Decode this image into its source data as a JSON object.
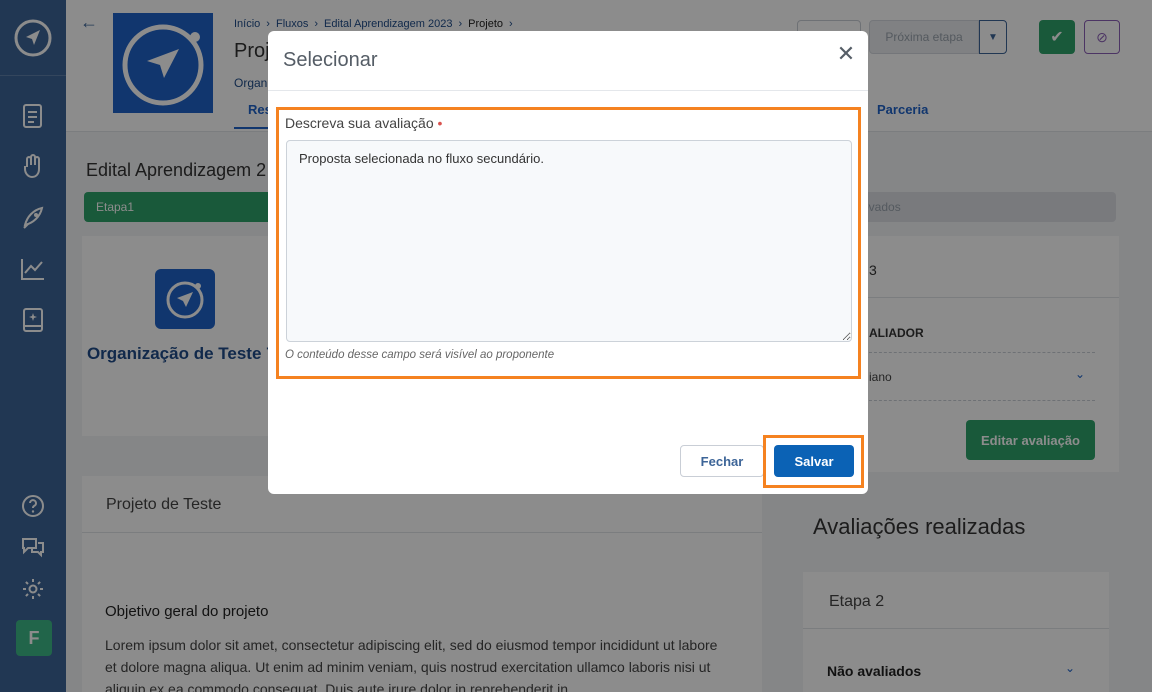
{
  "header": {
    "breadcrumb": [
      "Início",
      "Fluxos",
      "Edital Aprendizagem 2023",
      "Projeto"
    ],
    "project_title": "Proj",
    "org_subtitle": "Organ",
    "tab_res": "Res",
    "tab_parceria": "Parceria",
    "next_step_label": "Próxima etapa"
  },
  "page": {
    "edital_title": "Edital Aprendizagem 2",
    "etapa_label": "Etapa1",
    "aprovados_label": "rovados",
    "org_name": "Organização de Teste 72",
    "right_card_num": "3",
    "avaliador_label": "ALIADOR",
    "avaliador_name": "iano",
    "edit_button": "Editar avaliação",
    "project_card_title": "Projeto de Teste",
    "objective_title": "Objetivo geral do projeto",
    "lorem": "Lorem ipsum dolor sit amet, consectetur adipiscing elit, sed do eiusmod tempor incididunt ut labore et dolore magna aliqua. Ut enim ad minim veniam, quis nostrud exercitation ullamco laboris nisi ut aliquip ex ea commodo consequat. Duis aute irure dolor in reprehenderit in",
    "avaliacoes_title": "Avaliações realizadas",
    "aval_etapa": "Etapa 2",
    "aval_nao": "Não avaliados"
  },
  "sidebar": {
    "avatar_letter": "F",
    "icons": [
      "logo-icon",
      "document-icon",
      "hand-heart-icon",
      "rocket-icon",
      "chart-line-icon",
      "book-icon",
      "help-icon",
      "chat-icon",
      "gear-icon"
    ]
  },
  "modal": {
    "title": "Selecionar",
    "field_label": "Descreva sua avaliação",
    "field_value": "Proposta selecionada no fluxo secundário.",
    "field_help": "O conteúdo desse campo será visível ao proponente",
    "close_button": "Fechar",
    "save_button": "Salvar"
  },
  "colors": {
    "sidebar": "#3d6598",
    "highlight": "#f58220",
    "primary": "#0b62b5",
    "success": "#2fa36b"
  }
}
